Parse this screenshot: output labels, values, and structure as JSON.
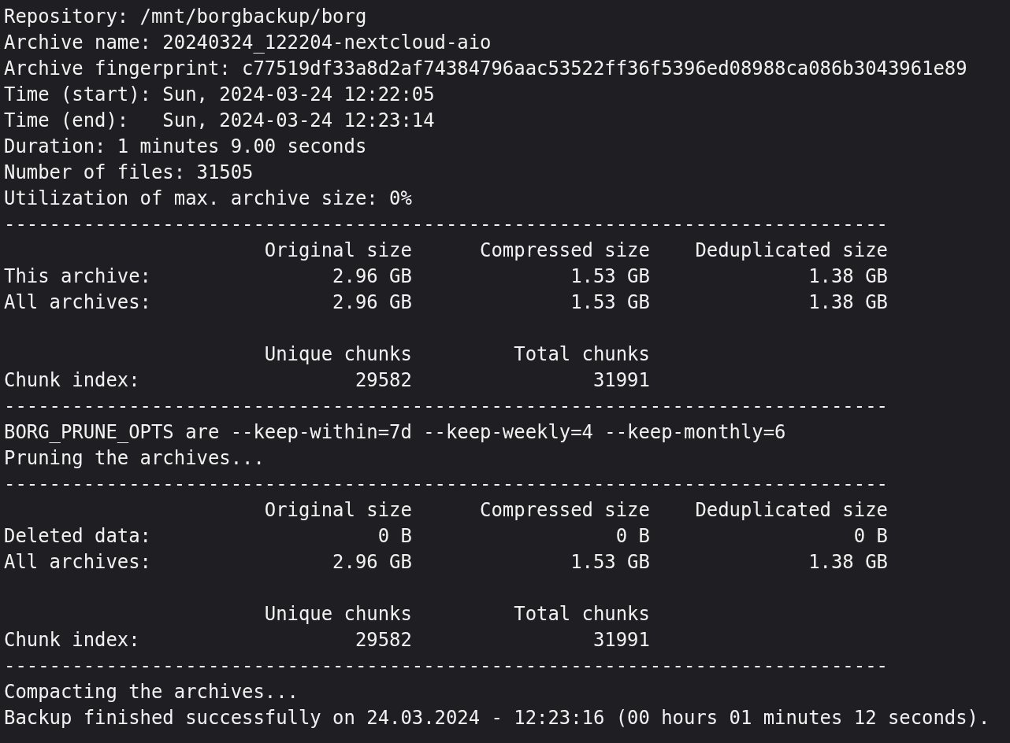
{
  "terminal": {
    "lines": [
      {
        "kind": "text",
        "text": "Repository: /mnt/borgbackup/borg"
      },
      {
        "kind": "text",
        "text": "Archive name: 20240324_122204-nextcloud-aio"
      },
      {
        "kind": "text",
        "text": "Archive fingerprint: c77519df33a8d2af74384796aac53522ff36f5396ed08988ca086b3043961e89"
      },
      {
        "kind": "text",
        "text": "Time (start): Sun, 2024-03-24 12:22:05"
      },
      {
        "kind": "text",
        "text": "Time (end):   Sun, 2024-03-24 12:23:14"
      },
      {
        "kind": "text",
        "text": "Duration: 1 minutes 9.00 seconds"
      },
      {
        "kind": "text",
        "text": "Number of files: 31505"
      },
      {
        "kind": "text",
        "text": "Utilization of max. archive size: 0%"
      },
      {
        "kind": "rule",
        "text": "------------------------------------------------------------------------------"
      },
      {
        "kind": "text",
        "text": "                       Original size      Compressed size    Deduplicated size"
      },
      {
        "kind": "text",
        "text": "This archive:                2.96 GB              1.53 GB              1.38 GB"
      },
      {
        "kind": "text",
        "text": "All archives:                2.96 GB              1.53 GB              1.38 GB"
      },
      {
        "kind": "blank"
      },
      {
        "kind": "text",
        "text": "                       Unique chunks         Total chunks"
      },
      {
        "kind": "text",
        "text": "Chunk index:                   29582                31991"
      },
      {
        "kind": "rule",
        "text": "------------------------------------------------------------------------------"
      },
      {
        "kind": "text",
        "text": "BORG_PRUNE_OPTS are --keep-within=7d --keep-weekly=4 --keep-monthly=6"
      },
      {
        "kind": "text",
        "text": "Pruning the archives..."
      },
      {
        "kind": "rule",
        "text": "------------------------------------------------------------------------------"
      },
      {
        "kind": "text",
        "text": "                       Original size      Compressed size    Deduplicated size"
      },
      {
        "kind": "text",
        "text": "Deleted data:                    0 B                  0 B                  0 B"
      },
      {
        "kind": "text",
        "text": "All archives:                2.96 GB              1.53 GB              1.38 GB"
      },
      {
        "kind": "blank"
      },
      {
        "kind": "text",
        "text": "                       Unique chunks         Total chunks"
      },
      {
        "kind": "text",
        "text": "Chunk index:                   29582                31991"
      },
      {
        "kind": "rule",
        "text": "------------------------------------------------------------------------------"
      },
      {
        "kind": "text",
        "text": "Compacting the archives..."
      },
      {
        "kind": "text",
        "text": "Backup finished successfully on 24.03.2024 - 12:23:16 (00 hours 01 minutes 12 seconds)."
      }
    ]
  }
}
